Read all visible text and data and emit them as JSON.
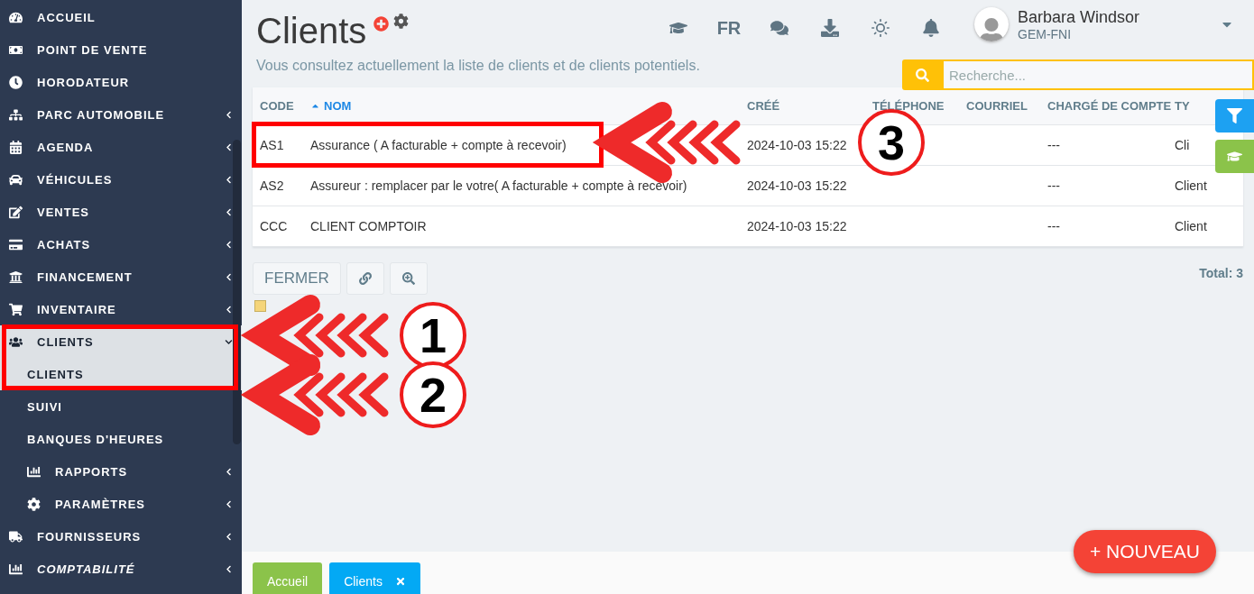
{
  "sidebar": {
    "items": [
      {
        "label": "ACCUEIL",
        "expandable": false,
        "expanded": false,
        "italic": false
      },
      {
        "label": "POINT DE VENTE",
        "expandable": false,
        "expanded": false,
        "italic": false
      },
      {
        "label": "HORODATEUR",
        "expandable": false,
        "expanded": false,
        "italic": false
      },
      {
        "label": "PARC AUTOMOBILE",
        "expandable": true,
        "expanded": false,
        "italic": false
      },
      {
        "label": "AGENDA",
        "expandable": true,
        "expanded": false,
        "italic": false
      },
      {
        "label": "VÉHICULES",
        "expandable": true,
        "expanded": false,
        "italic": false
      },
      {
        "label": "VENTES",
        "expandable": true,
        "expanded": false,
        "italic": false
      },
      {
        "label": "ACHATS",
        "expandable": true,
        "expanded": false,
        "italic": false
      },
      {
        "label": "FINANCEMENT",
        "expandable": true,
        "expanded": false,
        "italic": false
      },
      {
        "label": "INVENTAIRE",
        "expandable": true,
        "expanded": false,
        "italic": false
      },
      {
        "label": "CLIENTS",
        "expandable": true,
        "expanded": true,
        "italic": false,
        "children": [
          {
            "label": "CLIENTS",
            "selected": true,
            "expandable": false
          },
          {
            "label": "SUIVI",
            "selected": false,
            "expandable": false
          },
          {
            "label": "BANQUES D'HEURES",
            "selected": false,
            "expandable": false
          },
          {
            "label": "RAPPORTS",
            "selected": false,
            "expandable": true
          },
          {
            "label": "PARAMÈTRES",
            "selected": false,
            "expandable": true
          }
        ]
      },
      {
        "label": "FOURNISSEURS",
        "expandable": true,
        "expanded": false,
        "italic": false
      },
      {
        "label": "COMPTABILITÉ",
        "expandable": true,
        "expanded": false,
        "italic": true
      }
    ]
  },
  "header": {
    "title": "Clients",
    "subtitle": "Vous consultez actuellement la liste de clients et de clients potentiels.",
    "language": "FR",
    "user": {
      "name": "Barbara Windsor",
      "organization": "GEM-FNI"
    },
    "search": {
      "placeholder": "Recherche..."
    }
  },
  "table": {
    "columns": [
      {
        "label": "CODE",
        "sorted": false
      },
      {
        "label": "NOM",
        "sorted": true
      },
      {
        "label": "CRÉÉ",
        "sorted": false
      },
      {
        "label": "TÉLÉPHONE",
        "sorted": false
      },
      {
        "label": "COURRIEL",
        "sorted": false
      },
      {
        "label": "CHARGÉ DE COMPTE",
        "sorted": false
      },
      {
        "label": "TY",
        "sorted": false
      }
    ],
    "rows": [
      {
        "cells": [
          "AS1",
          "Assurance ( A facturable + compte à recevoir)",
          "2024-10-03 15:22",
          "",
          "",
          "---",
          "Cli"
        ]
      },
      {
        "cells": [
          "AS2",
          "Assureur : remplacer par le votre( A facturable + compte à recevoir)",
          "2024-10-03 15:22",
          "",
          "",
          "---",
          "Client"
        ]
      },
      {
        "cells": [
          "CCC",
          "CLIENT COMPTOIR",
          "2024-10-03 15:22",
          "",
          "",
          "---",
          "Client"
        ]
      }
    ]
  },
  "actions": {
    "close": "FERMER",
    "total": "Total: 3"
  },
  "legend": {
    "color": "#f5d57a"
  },
  "bottom_tabs": [
    {
      "label": "Accueil",
      "selected": false,
      "closable": false
    },
    {
      "label": "Clients",
      "selected": true,
      "closable": true
    }
  ],
  "new_button": "+ NOUVEAU",
  "annotations": [
    {
      "label": "1"
    },
    {
      "label": "2"
    },
    {
      "label": "3"
    }
  ]
}
